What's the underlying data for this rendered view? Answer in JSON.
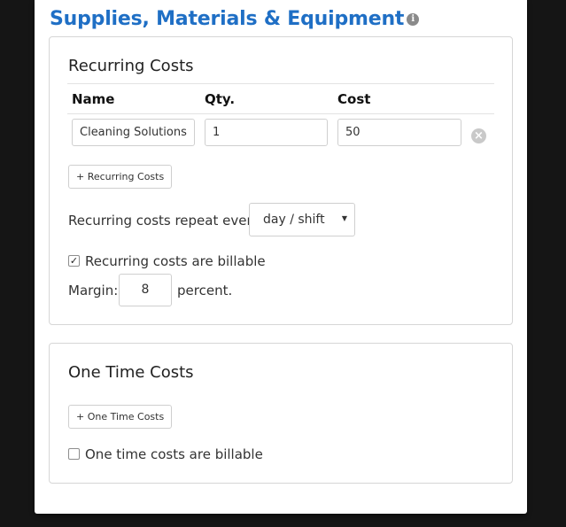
{
  "page": {
    "title": "Supplies, Materials & Equipment",
    "info_icon": "info-icon",
    "title_color": "#1f6fc5"
  },
  "recurring": {
    "title": "Recurring Costs",
    "columns": {
      "name": "Name",
      "qty": "Qty.",
      "cost": "Cost"
    },
    "rows": [
      {
        "name": "Cleaning Solutions",
        "qty": "1",
        "cost": "50"
      }
    ],
    "remove_icon": "remove-circle-icon",
    "add_button": "+ Recurring Costs",
    "repeat_label": "Recurring costs repeat every",
    "repeat_value": "day / shift",
    "billable_label": "Recurring costs are billable",
    "billable_checked": true,
    "margin_label": "Margin:",
    "margin_value": "8",
    "margin_suffix": "percent."
  },
  "onetime": {
    "title": "One Time Costs",
    "add_button": "+ One Time Costs",
    "billable_label": "One time costs are billable",
    "billable_checked": false
  }
}
